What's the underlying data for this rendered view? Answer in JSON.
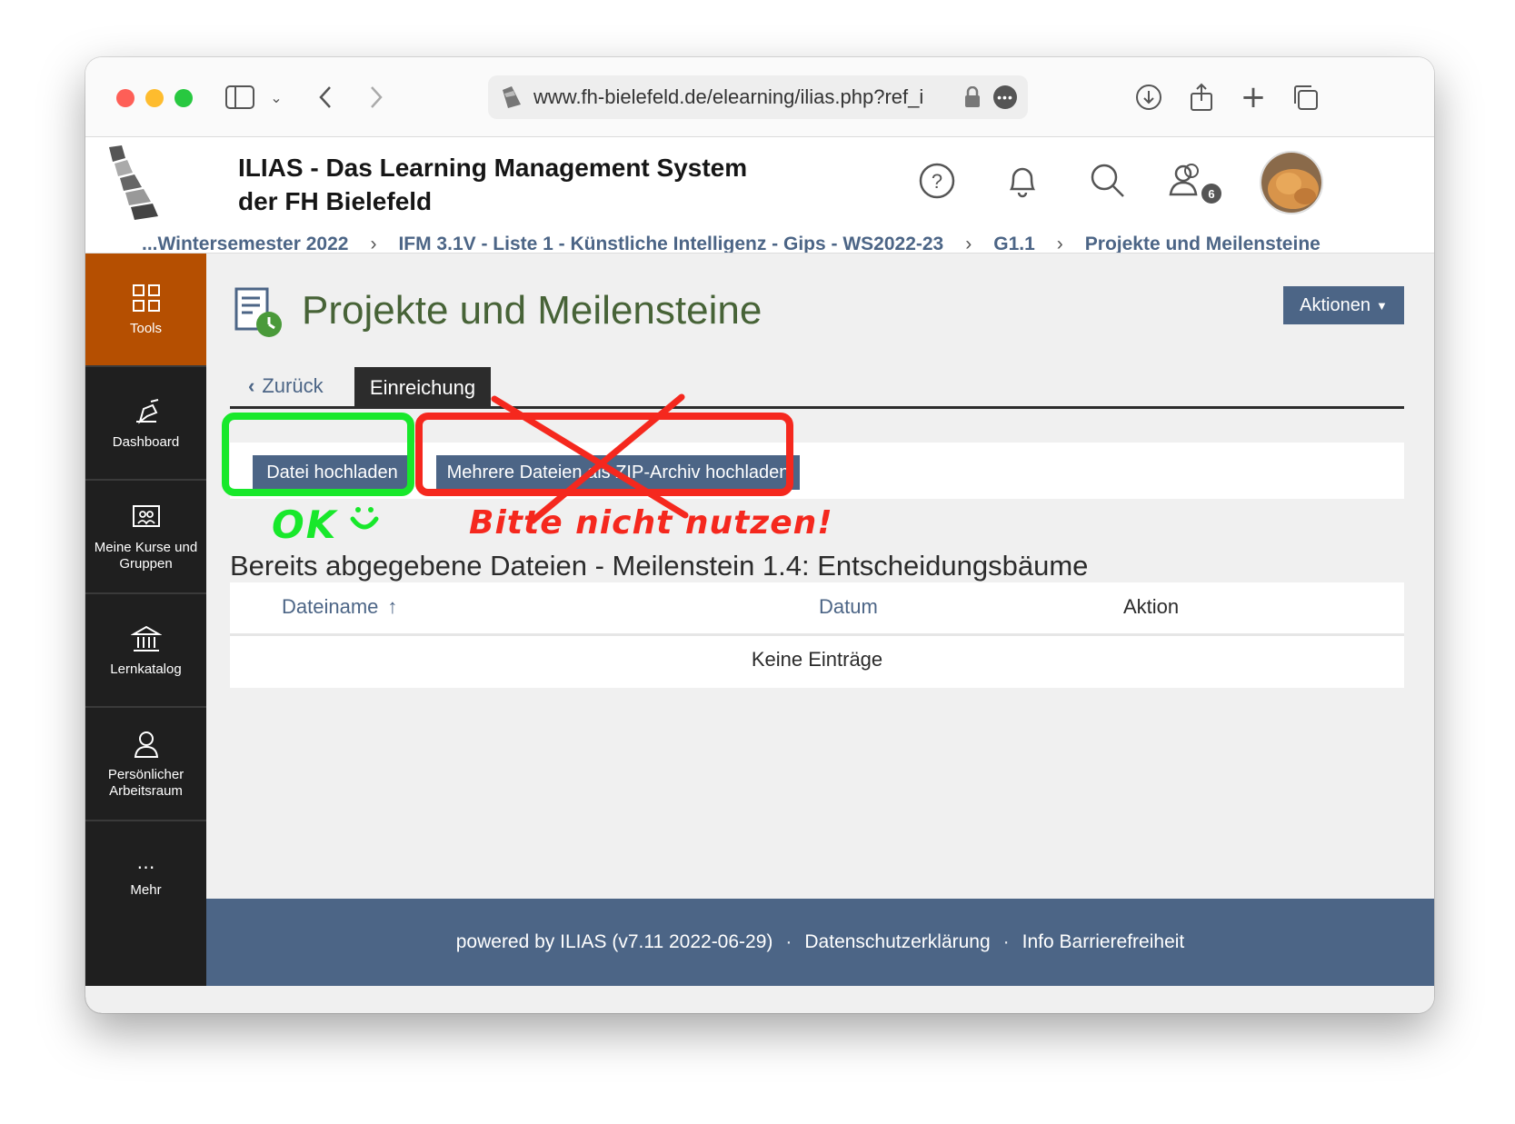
{
  "browser": {
    "url": "www.fh-bielefeld.de/elearning/ilias.php?ref_i"
  },
  "header": {
    "title_line1": "ILIAS - Das Learning Management System",
    "title_line2": "der FH Bielefeld",
    "notification_badge": "6"
  },
  "breadcrumb": [
    "...Wintersemester 2022",
    "IFM 3.1V - Liste 1 - Künstliche Intelligenz - Gips - WS2022-23",
    "G1.1",
    "Projekte und Meilensteine"
  ],
  "sidebar": {
    "items": [
      {
        "label": "Tools",
        "icon": "grid-icon",
        "active": true
      },
      {
        "label": "Dashboard",
        "icon": "dashboard-icon"
      },
      {
        "label": "Meine Kurse und Gruppen",
        "icon": "courses-icon"
      },
      {
        "label": "Lernkatalog",
        "icon": "catalog-icon"
      },
      {
        "label": "Persönlicher Arbeitsraum",
        "icon": "person-icon"
      },
      {
        "label": "Mehr",
        "icon": "more-icon"
      }
    ]
  },
  "main": {
    "page_title": "Projekte und Meilensteine",
    "actions_label": "Aktionen",
    "tab_back": "Zurück",
    "tab_active": "Einreichung",
    "upload_button": "Datei hochladen",
    "zip_button": "Mehrere Dateien als ZIP-Archiv hochladen",
    "section_title": "Bereits abgegebene Dateien - Meilenstein 1.4: Entscheidungsbäume",
    "table": {
      "columns": [
        "Dateiname",
        "Datum",
        "Aktion"
      ],
      "empty_text": "Keine Einträge"
    }
  },
  "footer": {
    "powered": "powered by ILIAS (v7.11 2022-06-29)",
    "privacy": "Datenschutzerklärung",
    "accessibility": "Info Barrierefreiheit"
  },
  "annotations": {
    "ok_text": "OK",
    "red_note": "Bitte nicht nutzen!",
    "ok_color": "#18e82b",
    "warn_color": "#f5281e"
  },
  "colors": {
    "ilias_blue": "#4c6586",
    "tools_orange": "#b54f01",
    "title_green": "#476337"
  }
}
